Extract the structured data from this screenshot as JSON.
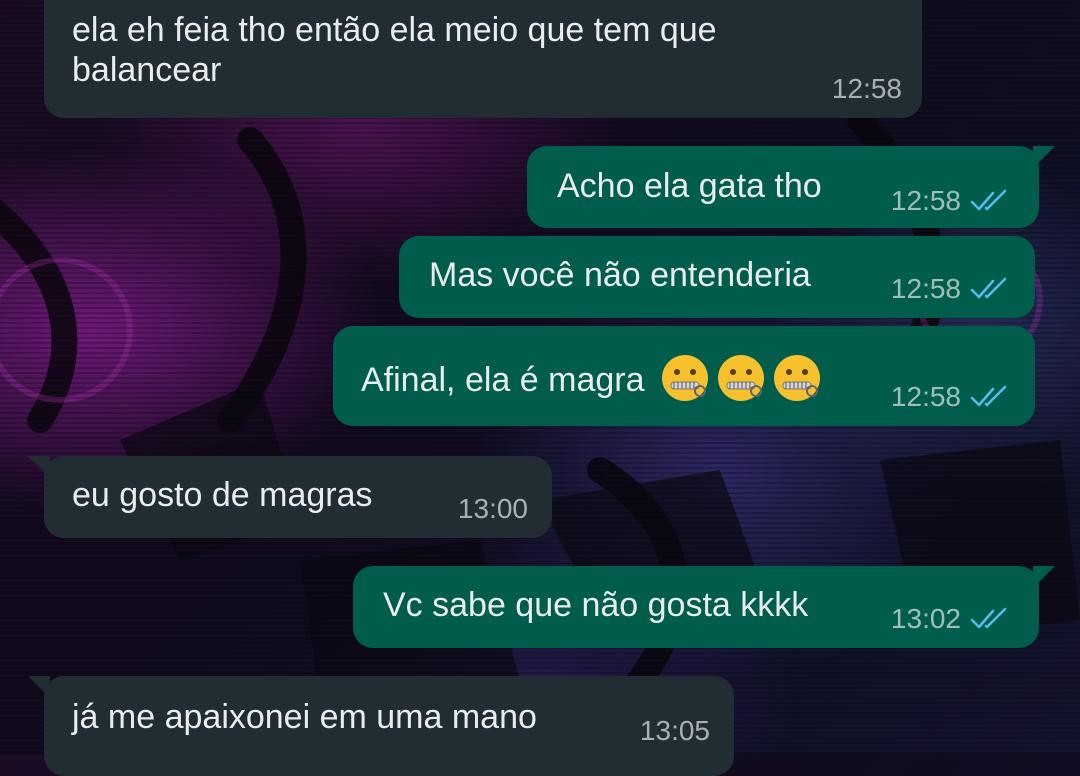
{
  "conversation": {
    "messages": [
      {
        "direction": "incoming",
        "lines": [
          "ela eh feia tho então ela meio que tem que",
          "balancear"
        ],
        "time": "12:58"
      },
      {
        "direction": "outgoing",
        "text": "Acho ela gata tho",
        "time": "12:58",
        "status": "read"
      },
      {
        "direction": "outgoing",
        "text": "Mas você não entenderia",
        "time": "12:58",
        "status": "read"
      },
      {
        "direction": "outgoing",
        "text": "Afinal, ela é magra",
        "emojis": [
          "zipper-mouth-face",
          "zipper-mouth-face",
          "zipper-mouth-face"
        ],
        "time": "12:58",
        "status": "read"
      },
      {
        "direction": "incoming",
        "text": "eu gosto de magras",
        "time": "13:00"
      },
      {
        "direction": "outgoing",
        "text": "Vc sabe que não gosta kkkk",
        "time": "13:02",
        "status": "read"
      },
      {
        "direction": "incoming",
        "text": "já me apaixonei em uma mano",
        "time": "13:05"
      }
    ]
  },
  "colors": {
    "incoming_bubble": "#222c33",
    "outgoing_bubble": "#005c4b",
    "read_ticks": "#53bdeb",
    "text": "#e9edef"
  },
  "icons": {
    "read_status": "double-check-icon",
    "emoji": "zipper-mouth-face-emoji"
  }
}
